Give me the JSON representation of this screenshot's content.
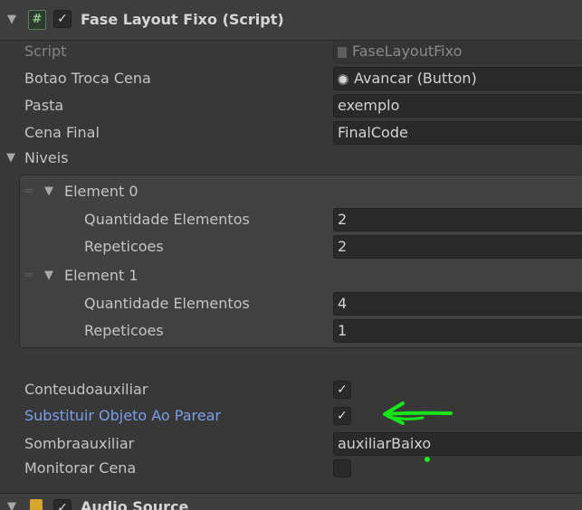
{
  "component": {
    "title": "Fase Layout Fixo (Script)",
    "enabled": true,
    "script_label": "Script",
    "script_value": "FaseLayoutFixo"
  },
  "fields": {
    "botao_troca_cena": {
      "label": "Botao Troca Cena",
      "value": "Avancar (Button)"
    },
    "pasta": {
      "label": "Pasta",
      "value": "exemplo"
    },
    "cena_final": {
      "label": "Cena Final",
      "value": "FinalCode"
    }
  },
  "niveis": {
    "label": "Niveis",
    "elements": [
      {
        "header": "Element 0",
        "qty_label": "Quantidade Elementos",
        "qty": "2",
        "rep_label": "Repeticoes",
        "rep": "2"
      },
      {
        "header": "Element 1",
        "qty_label": "Quantidade Elementos",
        "qty": "4",
        "rep_label": "Repeticoes",
        "rep": "1"
      }
    ]
  },
  "toggles": {
    "conteudo": {
      "label": "Conteudoauxiliar",
      "checked": true
    },
    "substituir": {
      "label": "Substituir Objeto Ao Parear",
      "checked": true
    },
    "sombra": {
      "label": "Sombraauxiliar",
      "value": "auxiliarBaixo"
    },
    "monitorar": {
      "label": "Monitorar Cena",
      "checked": false
    }
  },
  "next_component": {
    "title": "Audio Source"
  },
  "annotation": {
    "arrow_color": "#16e51a"
  }
}
